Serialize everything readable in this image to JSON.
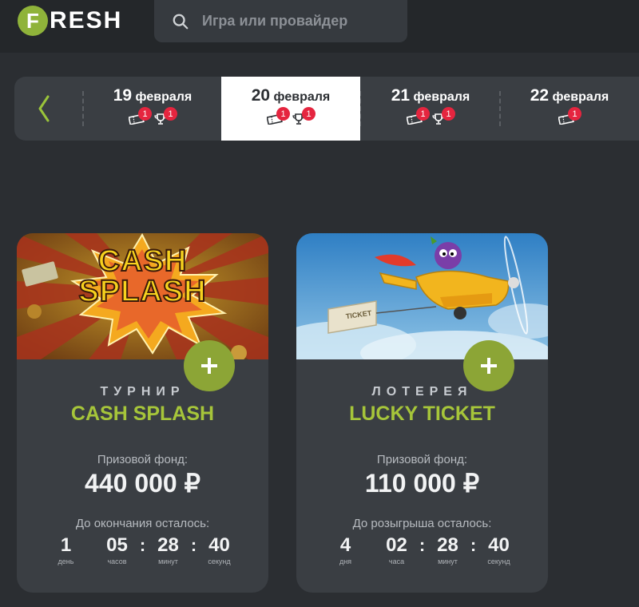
{
  "header": {
    "logo_letter": "F",
    "logo_rest": "RESH",
    "search_placeholder": "Игра или провайдер"
  },
  "dates": [
    {
      "day": "19",
      "month": "февраля",
      "active": false,
      "tickets": "1",
      "cups": "1"
    },
    {
      "day": "20",
      "month": "февраля",
      "active": true,
      "tickets": "1",
      "cups": "1"
    },
    {
      "day": "21",
      "month": "февраля",
      "active": false,
      "tickets": "1",
      "cups": "1"
    },
    {
      "day": "22",
      "month": "февраля",
      "active": false,
      "tickets": "1",
      "cups": null
    }
  ],
  "cards": [
    {
      "image_text_1": "CASH",
      "image_text_2": "SPLASH",
      "type": "ТУРНИР",
      "title": "CASH SPLASH",
      "prize_label": "Призовой фонд:",
      "prize_value": "440 000 ₽",
      "timer_label": "До окончания осталось:",
      "timer": [
        {
          "v": "1",
          "l": "день"
        },
        {
          "v": "05",
          "l": "часов"
        },
        {
          "v": "28",
          "l": "минут"
        },
        {
          "v": "40",
          "l": "секунд"
        }
      ]
    },
    {
      "image_text_1": "TICKET",
      "type": "ЛОТЕРЕЯ",
      "title": "LUCKY TICKET",
      "prize_label": "Призовой фонд:",
      "prize_value": "110 000 ₽",
      "timer_label": "До розыгрыша осталось:",
      "timer": [
        {
          "v": "4",
          "l": "дня"
        },
        {
          "v": "02",
          "l": "часа"
        },
        {
          "v": "28",
          "l": "минут"
        },
        {
          "v": "40",
          "l": "секунд"
        }
      ]
    }
  ],
  "colors": {
    "accent": "#a6c53a",
    "badge": "#e5253f",
    "plus": "#8ca536"
  }
}
